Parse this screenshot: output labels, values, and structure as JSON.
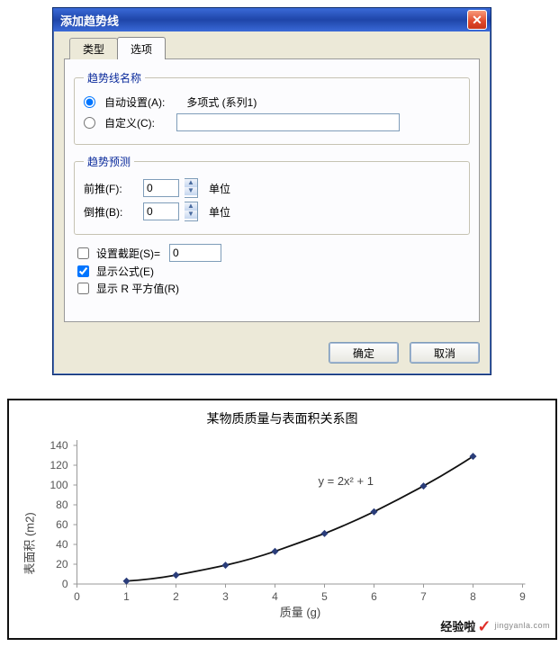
{
  "dialog": {
    "title": "添加趋势线",
    "tabs": {
      "type": "类型",
      "options": "选项"
    },
    "group_name": {
      "legend": "趋势线名称",
      "auto_label": "自动设置(A):",
      "auto_value": "多项式 (系列1)",
      "custom_label": "自定义(C):",
      "custom_value": ""
    },
    "group_forecast": {
      "legend": "趋势预测",
      "forward_label": "前推(F):",
      "forward_value": "0",
      "backward_label": "倒推(B):",
      "backward_value": "0",
      "unit": "单位"
    },
    "checks": {
      "intercept_label": "设置截距(S)=",
      "intercept_value": "0",
      "equation_label": "显示公式(E)",
      "rsq_label": "显示 R 平方值(R)"
    },
    "buttons": {
      "ok": "确定",
      "cancel": "取消"
    }
  },
  "chart": {
    "title": "某物质质量与表面积关系图",
    "xlabel": "质量 (g)",
    "ylabel": "表面积 (m2)",
    "equation": "y = 2x² + 1"
  },
  "chart_data": {
    "type": "line",
    "title": "某物质质量与表面积关系图",
    "xlabel": "质量 (g)",
    "ylabel": "表面积 (m2)",
    "xlim": [
      0,
      9
    ],
    "ylim": [
      0,
      140
    ],
    "x_ticks": [
      0,
      1,
      2,
      3,
      4,
      5,
      6,
      7,
      8,
      9
    ],
    "y_ticks": [
      0,
      20,
      40,
      60,
      80,
      100,
      120,
      140
    ],
    "equation": "y = 2x^2 + 1",
    "series": [
      {
        "name": "系列1",
        "x": [
          1,
          2,
          3,
          4,
          5,
          6,
          7,
          8
        ],
        "y": [
          3,
          9,
          19,
          33,
          51,
          73,
          99,
          129
        ]
      }
    ]
  },
  "watermark": {
    "brand": "经验啦",
    "site": "jingyanla.com"
  }
}
